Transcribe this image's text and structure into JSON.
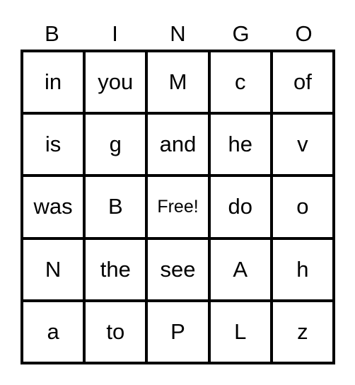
{
  "header": [
    "B",
    "I",
    "N",
    "G",
    "O"
  ],
  "cells": [
    [
      "in",
      "you",
      "M",
      "c",
      "of"
    ],
    [
      "is",
      "g",
      "and",
      "he",
      "v"
    ],
    [
      "was",
      "B",
      "Free!",
      "do",
      "o"
    ],
    [
      "N",
      "the",
      "see",
      "A",
      "h"
    ],
    [
      "a",
      "to",
      "P",
      "L",
      "z"
    ]
  ]
}
